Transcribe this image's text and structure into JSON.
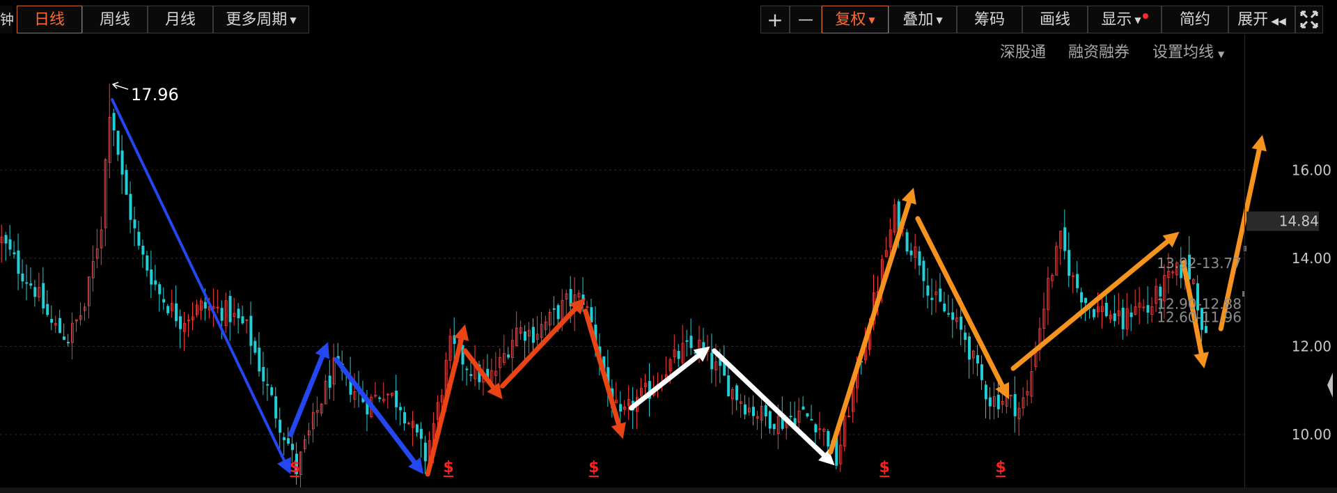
{
  "toolbar": {
    "left_edge_label": "钟",
    "day_label": "日线",
    "week_label": "周线",
    "month_label": "月线",
    "more_label": "更多周期",
    "plus_label": "+",
    "minus_label": "—",
    "fuquan_label": "复权",
    "overlay_label": "叠加",
    "chips_label": "筹码",
    "draw_label": "画线",
    "display_label": "显示",
    "simple_label": "简约",
    "expand_label": "展开",
    "expand_icon": "rewind-icon",
    "fullscreen_icon": "fullscreen-icon"
  },
  "subnav": {
    "shengutong": "深股通",
    "margin": "融资融券",
    "ma_settings": "设置均线"
  },
  "colors": {
    "up": "#ff3b3b",
    "down": "#22cfd6",
    "blue_arrow": "#2447f2",
    "red_arrow": "#ea4314",
    "white_arrow": "#ffffff",
    "orange_arrow": "#f6931e",
    "accent": "#ff6a33"
  },
  "chart_data": {
    "type": "candlestick",
    "y_ticks": [
      "16.00",
      "14.00",
      "12.00",
      "10.00"
    ],
    "ylim": [
      8.8,
      18.2
    ],
    "grid": "horizontal dotted",
    "current_price": "14.84",
    "peak_label": "17.96",
    "peak": {
      "index": 26,
      "price": 17.96
    },
    "levels": [
      {
        "text": "13.92-13.77",
        "price": 13.9
      },
      {
        "text": "12.90-12.88",
        "price": 12.95
      },
      {
        "text": "12.60-11.96",
        "price": 12.65
      }
    ],
    "bars": [
      {
        "index": 100,
        "from": 80,
        "to": 520
      },
      {
        "index": 70,
        "open": 14.0,
        "close": 13.5,
        "high": 14.3,
        "low": 13.2
      },
      {
        "index": 72,
        "open": 13.0,
        "close": 12.4,
        "high": 13.3,
        "low": 12.1
      }
    ],
    "path": [
      [
        0,
        14.4
      ],
      [
        4,
        13.8
      ],
      [
        8,
        13.3
      ],
      [
        12,
        12.5
      ],
      [
        16,
        12.2
      ],
      [
        20,
        12.9
      ],
      [
        24,
        14.8
      ],
      [
        26,
        17.6
      ],
      [
        29,
        15.8
      ],
      [
        33,
        14.2
      ],
      [
        38,
        13.2
      ],
      [
        43,
        12.6
      ],
      [
        48,
        12.9
      ],
      [
        54,
        12.8
      ],
      [
        59,
        12.4
      ],
      [
        63,
        11.3
      ],
      [
        66,
        10.5
      ],
      [
        69,
        9.8
      ],
      [
        71,
        9.2
      ],
      [
        74,
        10.0
      ],
      [
        77,
        10.8
      ],
      [
        80,
        11.5
      ],
      [
        84,
        11.1
      ],
      [
        88,
        10.7
      ],
      [
        92,
        11.0
      ],
      [
        96,
        10.7
      ],
      [
        99,
        10.1
      ],
      [
        102,
        9.5
      ],
      [
        105,
        10.6
      ],
      [
        108,
        12.0
      ],
      [
        111,
        11.7
      ],
      [
        114,
        11.4
      ],
      [
        117,
        11.2
      ],
      [
        120,
        11.6
      ],
      [
        124,
        12.4
      ],
      [
        128,
        12.3
      ],
      [
        132,
        12.6
      ],
      [
        136,
        13.0
      ],
      [
        140,
        13.1
      ],
      [
        143,
        12.2
      ],
      [
        146,
        11.0
      ],
      [
        149,
        10.3
      ],
      [
        152,
        10.7
      ],
      [
        156,
        11.0
      ],
      [
        160,
        11.5
      ],
      [
        164,
        11.9
      ],
      [
        168,
        12.0
      ],
      [
        172,
        11.5
      ],
      [
        176,
        11.0
      ],
      [
        180,
        10.6
      ],
      [
        184,
        10.4
      ],
      [
        188,
        10.3
      ],
      [
        192,
        10.5
      ],
      [
        196,
        10.3
      ],
      [
        199,
        9.9
      ],
      [
        201,
        9.4
      ],
      [
        204,
        10.6
      ],
      [
        207,
        11.8
      ],
      [
        210,
        13.0
      ],
      [
        213,
        14.2
      ],
      [
        215,
        15.0
      ],
      [
        218,
        14.4
      ],
      [
        221,
        14.0
      ],
      [
        224,
        13.1
      ],
      [
        228,
        12.7
      ],
      [
        232,
        12.2
      ],
      [
        235,
        11.4
      ],
      [
        238,
        10.8
      ],
      [
        242,
        10.8
      ],
      [
        245,
        10.6
      ],
      [
        247,
        10.9
      ],
      [
        249,
        12.0
      ],
      [
        252,
        13.4
      ],
      [
        255,
        14.4
      ],
      [
        258,
        13.5
      ],
      [
        262,
        12.9
      ],
      [
        266,
        12.8
      ],
      [
        270,
        12.5
      ],
      [
        273,
        13.0
      ],
      [
        276,
        12.8
      ],
      [
        279,
        13.3
      ],
      [
        282,
        13.6
      ],
      [
        285,
        13.8
      ],
      [
        287,
        13.5
      ],
      [
        290,
        12.1
      ]
    ],
    "signals": [
      {
        "index": 71,
        "label": "$"
      },
      {
        "index": 108,
        "label": "$"
      },
      {
        "index": 143,
        "label": "$"
      },
      {
        "index": 213,
        "label": "$"
      },
      {
        "index": 241,
        "label": "$"
      }
    ],
    "arrows": [
      {
        "color": "blue",
        "from": [
          27,
          17.6
        ],
        "to": [
          70,
          9.1
        ]
      },
      {
        "color": "blue",
        "from": [
          70,
          10.0
        ],
        "to": [
          79,
          12.1
        ]
      },
      {
        "color": "blue",
        "from": [
          81,
          11.7
        ],
        "to": [
          102,
          9.1
        ]
      },
      {
        "color": "red",
        "from": [
          103,
          9.1
        ],
        "to": [
          112,
          12.5
        ]
      },
      {
        "color": "red",
        "from": [
          112,
          11.9
        ],
        "to": [
          121,
          10.8
        ]
      },
      {
        "color": "red",
        "from": [
          121,
          11.1
        ],
        "to": [
          141,
          13.1
        ]
      },
      {
        "color": "red",
        "from": [
          141,
          12.8
        ],
        "to": [
          150,
          9.9
        ]
      },
      {
        "color": "white",
        "from": [
          152,
          10.6
        ],
        "to": [
          171,
          12.0
        ]
      },
      {
        "color": "white",
        "from": [
          172,
          11.9
        ],
        "to": [
          201,
          9.3
        ]
      },
      {
        "color": "orange",
        "from": [
          200,
          9.6
        ],
        "to": [
          220,
          15.6
        ]
      },
      {
        "color": "orange",
        "from": [
          221,
          14.9
        ],
        "to": [
          243,
          10.8
        ]
      },
      {
        "color": "orange",
        "from": [
          244,
          11.5
        ],
        "to": [
          284,
          14.6
        ]
      },
      {
        "color": "orange",
        "from": [
          285,
          13.9
        ],
        "to": [
          290,
          11.5
        ]
      },
      {
        "color": "orange",
        "from": [
          294,
          12.4
        ],
        "to": [
          304,
          16.8
        ]
      }
    ],
    "markers": {
      "count": 0
    }
  }
}
